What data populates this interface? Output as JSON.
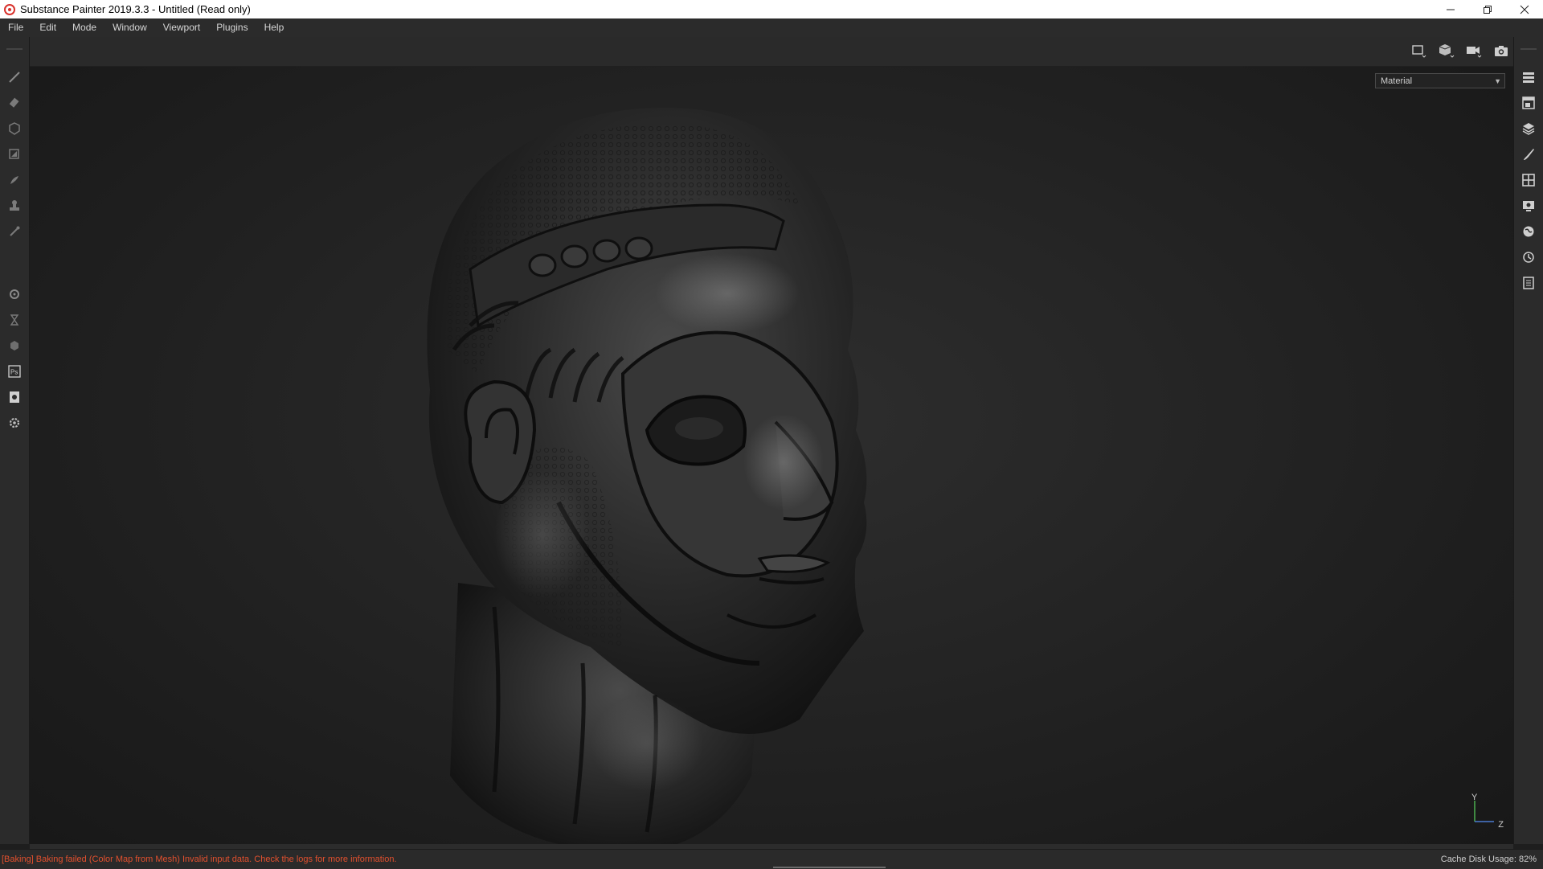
{
  "window": {
    "title": "Substance Painter 2019.3.3 - Untitled (Read only)",
    "controls": [
      "minimize-icon",
      "restore-icon",
      "close-icon"
    ]
  },
  "menu": {
    "items": [
      "File",
      "Edit",
      "Mode",
      "Window",
      "Viewport",
      "Plugins",
      "Help"
    ]
  },
  "toolbar": {
    "icons": [
      "2d-view-icon",
      "3d-view-icon",
      "camera-icon",
      "screenshot-icon"
    ]
  },
  "left_tools": [
    "paint-brush-icon",
    "eraser-icon",
    "projection-icon",
    "polygon-fill-icon",
    "smudge-icon",
    "clone-icon",
    "color-picker-icon",
    "bake-settings-icon",
    "hourglass-icon",
    "iray-icon",
    "photoshop-icon",
    "export-icon",
    "settings-icon"
  ],
  "right_dock": [
    "layers-list-icon",
    "texture-set-icon",
    "layers-icon",
    "brush-properties-icon",
    "texture-set-settings-icon",
    "display-settings-icon",
    "environment-icon",
    "history-icon",
    "log-icon"
  ],
  "viewport": {
    "mode_select": {
      "value": "Material"
    },
    "axis": {
      "y": "Y",
      "z": "Z"
    }
  },
  "status": {
    "message": "[Baking] Baking failed (Color Map from Mesh) Invalid input data. Check the logs for more information.",
    "cache_label": "Cache Disk Usage:",
    "cache_value": "82%"
  },
  "colors": {
    "error": "#e2502e",
    "panel": "#2b2b2b",
    "viewport": "#262626"
  }
}
